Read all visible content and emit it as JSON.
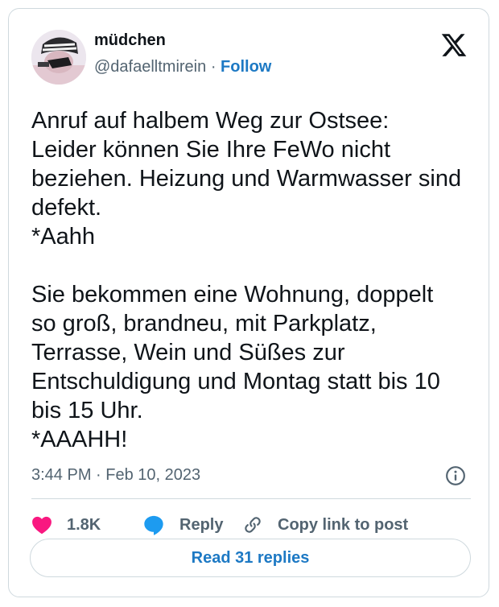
{
  "author": {
    "display_name": "müdchen",
    "handle": "@dafaelltmirein",
    "separator": "·",
    "follow_label": "Follow"
  },
  "tweet": {
    "text": "Anruf auf halbem Weg zur Ostsee:\nLeider können Sie Ihre FeWo nicht\nbeziehen. Heizung und Warmwasser sind\ndefekt.\n*Aahh\n\nSie bekommen eine Wohnung, doppelt\nso groß, brandneu, mit Parkplatz,\nTerrasse, Wein und Süßes zur\nEntschuldigung und Montag statt bis 10\nbis 15 Uhr.\n*AAAHH!",
    "timestamp": "3:44 PM · Feb 10, 2023"
  },
  "actions": {
    "like_count": "1.8K",
    "reply_label": "Reply",
    "copy_link_label": "Copy link to post"
  },
  "footer": {
    "read_replies_label": "Read 31 replies"
  },
  "colors": {
    "accent": "#1d79c4",
    "like": "#f91880",
    "reply_bubble": "#1d9bf0",
    "text": "#0f1419",
    "muted": "#536471",
    "border": "#cfd9de"
  },
  "icons": {
    "brand": "x-logo-icon",
    "like": "heart-icon",
    "reply": "speech-bubble-icon",
    "copy": "link-icon",
    "info": "info-icon"
  }
}
